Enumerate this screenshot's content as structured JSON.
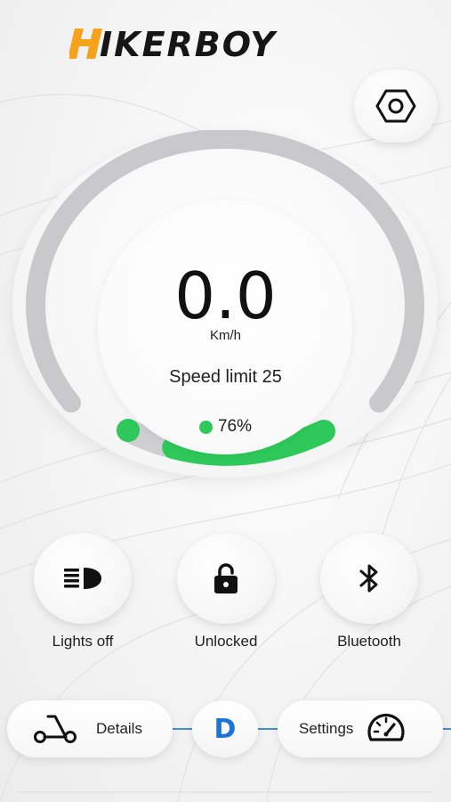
{
  "brand": {
    "name": "IKERBOY",
    "accent": "#f5a31a"
  },
  "speedometer": {
    "speed": "0.0",
    "unit": "Km/h",
    "speed_limit_text": "Speed limit 25",
    "battery_text": "76%",
    "battery_level": 0.76,
    "colors": {
      "track": "#c9c9cc",
      "battery": "#2ec95a"
    }
  },
  "controls": {
    "lights": {
      "label": "Lights off",
      "icon": "headlight-icon"
    },
    "lock": {
      "label": "Unlocked",
      "icon": "padlock-icon"
    },
    "bluetooth": {
      "label": "Bluetooth",
      "icon": "bluetooth-icon"
    }
  },
  "bottom_bar": {
    "details_label": "Details",
    "gear_mode": "D",
    "settings_label": "Settings",
    "line_color": "#3f8ddc"
  },
  "header": {
    "settings_icon": "hexagon-settings-icon"
  }
}
